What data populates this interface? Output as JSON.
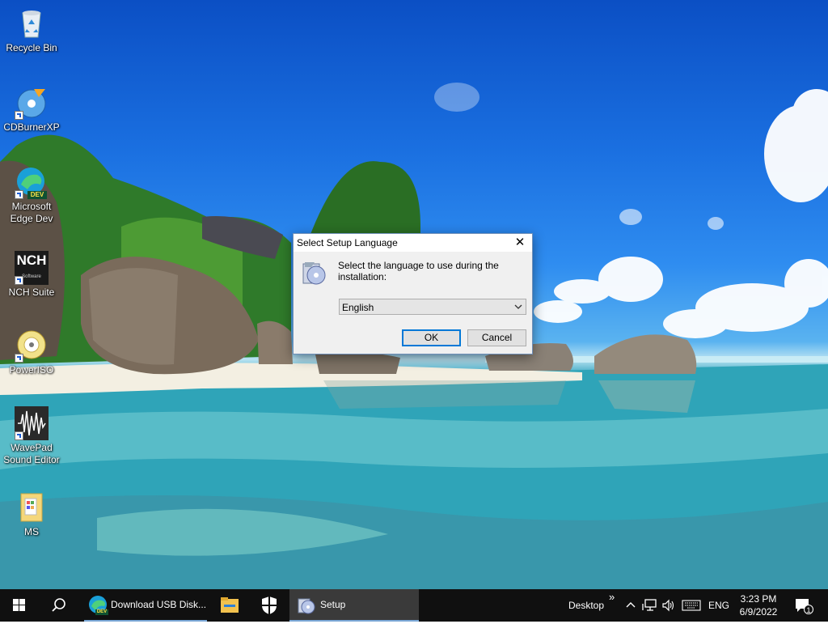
{
  "desktop_icons": [
    {
      "label": "Recycle Bin",
      "icon": "recycle-bin-icon"
    },
    {
      "label": "CDBurnerXP",
      "icon": "cdburnerxp-icon"
    },
    {
      "label": "Microsoft Edge Dev",
      "line1": "Microsoft",
      "line2": "Edge Dev",
      "icon": "edge-dev-icon",
      "badge": "DEV"
    },
    {
      "label": "NCH Suite",
      "icon": "nch-suite-icon",
      "logo_text": "NCH",
      "logo_sub": "Software"
    },
    {
      "label": "PowerISO",
      "icon": "poweriso-icon"
    },
    {
      "label": "WavePad Sound Editor",
      "line1": "WavePad",
      "line2": "Sound Editor",
      "icon": "wavepad-icon"
    },
    {
      "label": "MS",
      "icon": "folder-icon"
    }
  ],
  "dialog": {
    "title": "Select Setup Language",
    "message": "Select the language to use during the installation:",
    "language_value": "English",
    "ok_label": "OK",
    "cancel_label": "Cancel",
    "close_glyph": "✕"
  },
  "taskbar": {
    "apps": [
      {
        "label": "Download USB Disk...",
        "icon": "edge-dev-icon",
        "badge": "DEV"
      },
      {
        "label": "",
        "icon": "file-explorer-icon"
      },
      {
        "label": "",
        "icon": "windows-security-icon"
      },
      {
        "label": "Setup",
        "icon": "setup-icon"
      }
    ],
    "desktop_label": "Desktop",
    "desktop_chevron": "»",
    "language": "ENG",
    "time": "3:23 PM",
    "date": "6/9/2022",
    "notification_count": "1"
  },
  "colors": {
    "taskbar_bg": "#101010",
    "accent": "#0078d7",
    "dialog_bg": "#f0f0f0"
  }
}
